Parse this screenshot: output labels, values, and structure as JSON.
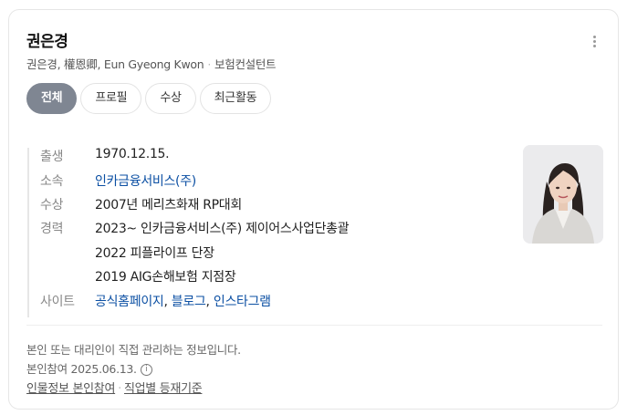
{
  "profile": {
    "name": "권은경",
    "aliases": "권은경, 權恩卿, Eun Gyeong Kwon",
    "occupation": "보험컨설턴트"
  },
  "tabs": [
    {
      "label": "전체",
      "active": true
    },
    {
      "label": "프로필",
      "active": false
    },
    {
      "label": "수상",
      "active": false
    },
    {
      "label": "최근활동",
      "active": false
    }
  ],
  "info": {
    "birth_label": "출생",
    "birth_value": "1970.12.15.",
    "affiliation_label": "소속",
    "affiliation_value": "인카금융서비스(주)",
    "award_label": "수상",
    "award_value": "2007년 메리츠화재 RP대회",
    "career_label": "경력",
    "career": [
      "2023~ 인카금융서비스(주) 제이어스사업단총괄",
      "2022 피플라이프 단장",
      "2019 AIG손해보험 지점장"
    ],
    "site_label": "사이트",
    "sites": [
      "공식홈페이지",
      "블로그",
      "인스타그램"
    ],
    "site_sep": ", "
  },
  "notes": {
    "managed": "본인 또는 대리인이 직접 관리하는 정보입니다.",
    "verified": "본인참여 2025.06.13.",
    "info_icon": "i"
  },
  "footer": {
    "link1": "인물정보 본인참여",
    "sep": "·",
    "link2": "직업별 등재기준"
  },
  "colors": {
    "active_tab": "#7f8692",
    "link": "#0b4fa3"
  }
}
